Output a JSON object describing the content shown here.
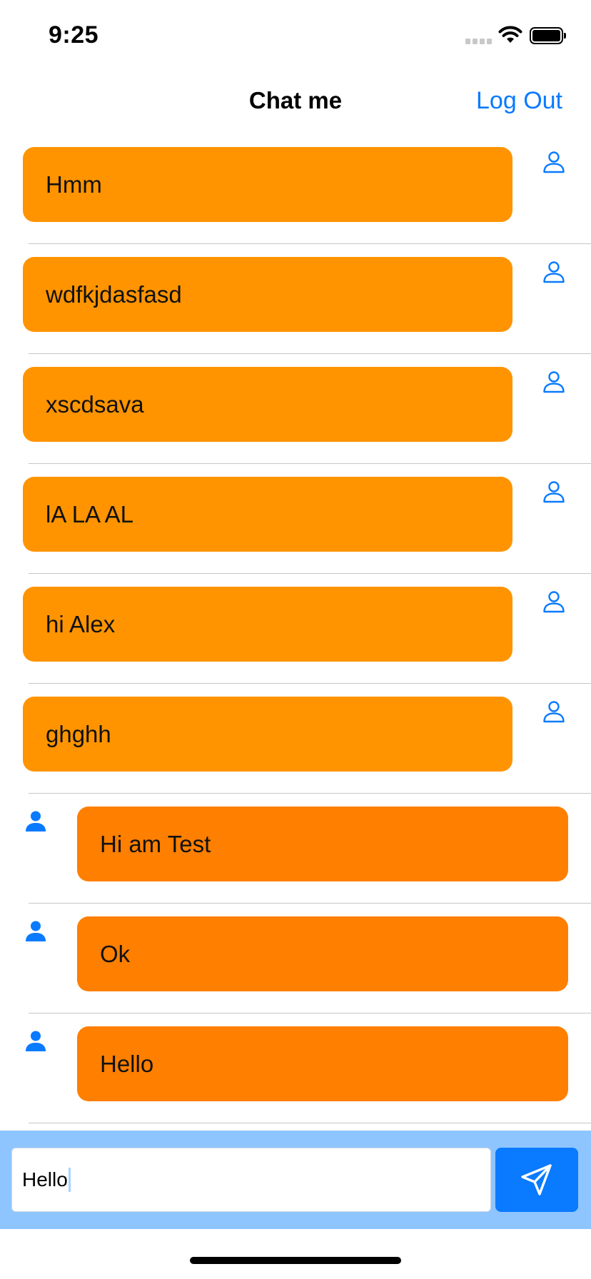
{
  "status_bar": {
    "time": "9:25"
  },
  "nav": {
    "title": "Chat me",
    "logout_label": "Log Out"
  },
  "messages": [
    {
      "text": "Hmm",
      "side": "in"
    },
    {
      "text": "wdfkjdasfasd",
      "side": "in"
    },
    {
      "text": "xscdsava",
      "side": "in"
    },
    {
      "text": "lA LA AL",
      "side": "in"
    },
    {
      "text": "hi Alex",
      "side": "in"
    },
    {
      "text": "ghghh",
      "side": "in"
    },
    {
      "text": "Hi am Test",
      "side": "out"
    },
    {
      "text": "Ok",
      "side": "out"
    },
    {
      "text": "Hello",
      "side": "out"
    }
  ],
  "composer": {
    "input_value": "Hello"
  },
  "colors": {
    "accent": "#0a7aff",
    "incoming_bubble": "#ff9400",
    "outgoing_bubble": "#ff7f00",
    "composer_bg": "#8ec5ff"
  },
  "icons": {
    "incoming_avatar": "person-outline-icon",
    "outgoing_avatar": "person-fill-icon",
    "send": "paper-plane-icon"
  }
}
